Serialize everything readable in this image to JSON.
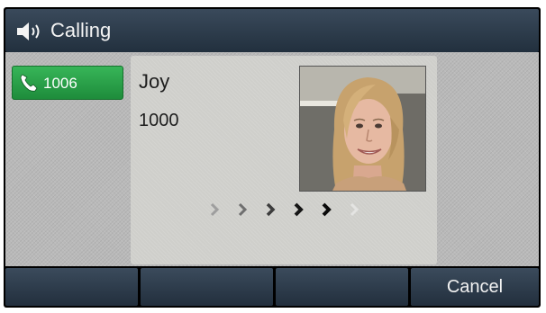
{
  "status_bar": {
    "icon": "speaker-icon",
    "title": "Calling"
  },
  "line_key": {
    "icon": "handset-icon",
    "label": "1006",
    "color": "#2aa14a"
  },
  "call": {
    "caller_name": "Joy",
    "caller_number": "1000",
    "photo": "caller-photo",
    "progress_arrows_total": 6
  },
  "softkeys": [
    "",
    "",
    "",
    "Cancel"
  ]
}
